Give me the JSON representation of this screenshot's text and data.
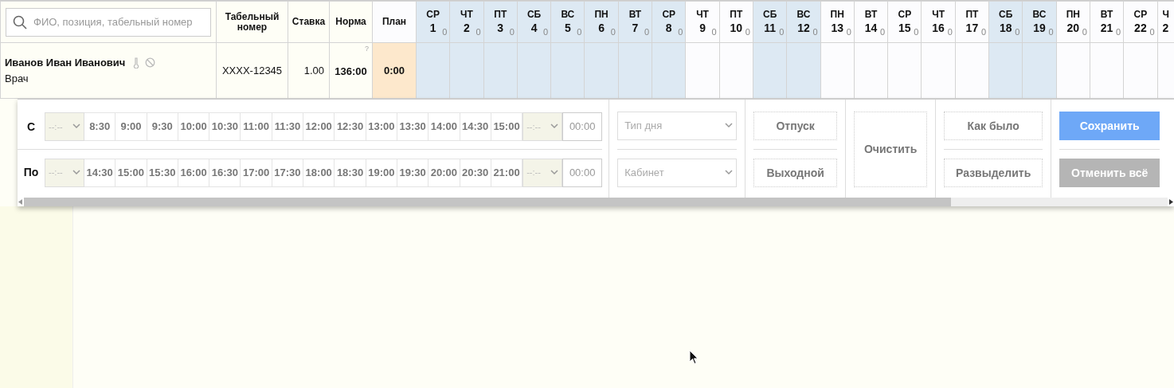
{
  "search": {
    "placeholder": "ФИО, позиция, табельный номер"
  },
  "columns": [
    "Табельный номер",
    "Ставка",
    "Норма",
    "План"
  ],
  "days": [
    {
      "weekday": "СР",
      "day": "1",
      "count": "0",
      "shaded": true
    },
    {
      "weekday": "ЧТ",
      "day": "2",
      "count": "0",
      "shaded": true
    },
    {
      "weekday": "ПТ",
      "day": "3",
      "count": "0",
      "shaded": true
    },
    {
      "weekday": "СБ",
      "day": "4",
      "count": "0",
      "shaded": true
    },
    {
      "weekday": "ВС",
      "day": "5",
      "count": "0",
      "shaded": true
    },
    {
      "weekday": "ПН",
      "day": "6",
      "count": "0",
      "shaded": true
    },
    {
      "weekday": "ВТ",
      "day": "7",
      "count": "0",
      "shaded": true
    },
    {
      "weekday": "СР",
      "day": "8",
      "count": "0",
      "shaded": true
    },
    {
      "weekday": "ЧТ",
      "day": "9",
      "count": "0",
      "shaded": false
    },
    {
      "weekday": "ПТ",
      "day": "10",
      "count": "0",
      "shaded": false
    },
    {
      "weekday": "СБ",
      "day": "11",
      "count": "0",
      "shaded": true
    },
    {
      "weekday": "ВС",
      "day": "12",
      "count": "0",
      "shaded": true
    },
    {
      "weekday": "ПН",
      "day": "13",
      "count": "0",
      "shaded": false
    },
    {
      "weekday": "ВТ",
      "day": "14",
      "count": "0",
      "shaded": false
    },
    {
      "weekday": "СР",
      "day": "15",
      "count": "0",
      "shaded": false
    },
    {
      "weekday": "ЧТ",
      "day": "16",
      "count": "0",
      "shaded": false
    },
    {
      "weekday": "ПТ",
      "day": "17",
      "count": "0",
      "shaded": false
    },
    {
      "weekday": "СБ",
      "day": "18",
      "count": "0",
      "shaded": true
    },
    {
      "weekday": "ВС",
      "day": "19",
      "count": "0",
      "shaded": true
    },
    {
      "weekday": "ПН",
      "day": "20",
      "count": "0",
      "shaded": false
    },
    {
      "weekday": "ВТ",
      "day": "21",
      "count": "0",
      "shaded": false
    },
    {
      "weekday": "СР",
      "day": "22",
      "count": "0",
      "shaded": false
    },
    {
      "weekday": "Ч",
      "day": "2",
      "shaded": false
    }
  ],
  "employee": {
    "name": "Иванов Иван Иванович",
    "position": "Врач",
    "tab_number": "XXXX-12345",
    "rate": "1.00",
    "norm": "136:00",
    "norm_hint": "?",
    "plan": "0:00"
  },
  "editor": {
    "rows": [
      {
        "label": "С",
        "start": "--:--",
        "slots": [
          "8:30",
          "9:00",
          "9:30",
          "10:00",
          "10:30",
          "11:00",
          "11:30",
          "12:00",
          "12:30",
          "13:00",
          "13:30",
          "14:00",
          "14:30",
          "15:00"
        ],
        "end": "--:--",
        "total": "00:00"
      },
      {
        "label": "По",
        "start": "--:--",
        "slots": [
          "14:30",
          "15:00",
          "15:30",
          "16:00",
          "16:30",
          "17:00",
          "17:30",
          "18:00",
          "18:30",
          "19:00",
          "19:30",
          "20:00",
          "20:30",
          "21:00"
        ],
        "end": "--:--",
        "total": "00:00"
      }
    ],
    "day_type": {
      "placeholder": "Тип дня"
    },
    "cabinet": {
      "placeholder": "Кабинет"
    },
    "vacation_button": {
      "label": "Отпуск"
    },
    "day_off_button": {
      "label": "Выходной"
    },
    "clear_button": {
      "label": "Очистить"
    },
    "revert_button": {
      "label": "Как было"
    },
    "deselect_button": {
      "label": "Развыделить"
    },
    "save_button": {
      "label": "Сохранить",
      "disabled": false
    },
    "cancel_all_button": {
      "label": "Отменить всё",
      "disabled": true
    }
  }
}
